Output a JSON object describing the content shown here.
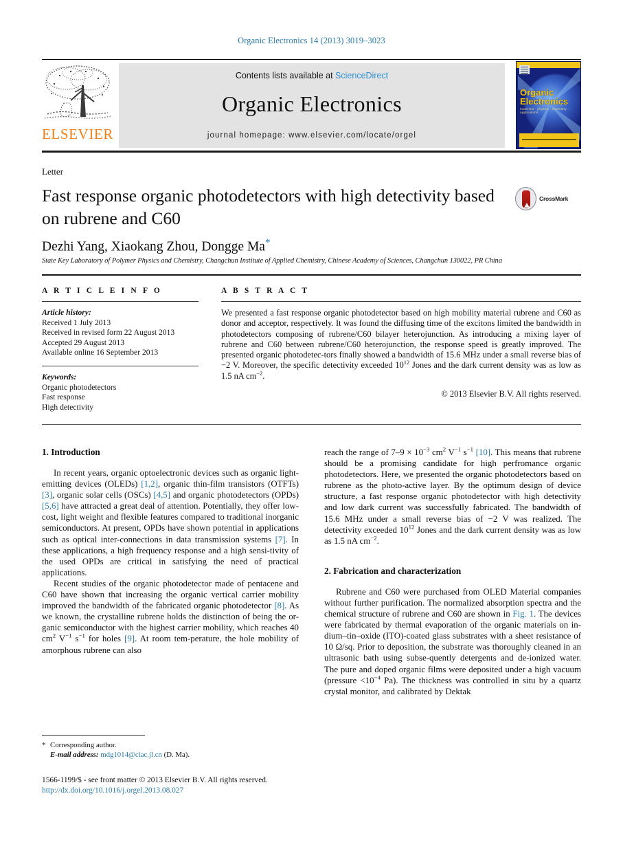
{
  "running_head": "Organic Electronics 14 (2013) 3019–3023",
  "masthead": {
    "contents_prefix": "Contents lists available at ",
    "sciencedirect": "ScienceDirect",
    "journal_name": "Organic Electronics",
    "homepage": "journal homepage: www.elsevier.com/locate/orgel",
    "publisher": "ELSEVIER",
    "cover": {
      "title": "Organic Electronics",
      "subtitle": "materials · physics · chemistry · applications"
    },
    "colors": {
      "link": "#2b8fd6",
      "elsevier_orange": "#f08019",
      "band_grey": "#e3e3e3",
      "cover_blue": "#14227a",
      "cover_yellow": "#f2c41a"
    }
  },
  "article": {
    "type_label": "Letter",
    "title": "Fast response organic photodetectors with high detectivity based on rubrene and C60",
    "authors": "Dezhi Yang, Xiaokang Zhou, Dongge Ma",
    "corresponding_marker": "*",
    "affiliation": "State Key Laboratory of Polymer Physics and Chemistry, Changchun Institute of Applied Chemistry, Chinese Academy of Sciences, Changchun 130022, PR China",
    "crossmark_label": "CrossMark"
  },
  "article_info": {
    "heading": "A R T I C L E    I N F O",
    "history_label": "Article history:",
    "history": [
      "Received 1 July 2013",
      "Received in revised form 22 August 2013",
      "Accepted 29 August 2013",
      "Available online 16 September 2013"
    ],
    "keywords_label": "Keywords:",
    "keywords": [
      "Organic photodetectors",
      "Fast response",
      "High detectivity"
    ]
  },
  "abstract": {
    "heading": "A B S T R A C T",
    "paragraph_1": "We presented a fast response organic photodetector based on high mobility material rubrene and C60 as donor and acceptor, respectively. It was found the diffusing time of the excitons limited the bandwidth in photodetectors composing of rubrene/C60 bilayer heterojunction. As introducing a mixing layer of rubrene and C60 between rubrene/C60 heterojunction, the response speed is greatly improved. The presented organic photodetec-tors finally showed a bandwidth of 15.6 MHz under a small reverse bias of −2 V. Moreover, the specific detectivity exceeded 10",
    "exponent_1": "12",
    "paragraph_1_cont": " Jones and the dark current density was as low as 1.5 nA cm",
    "exponent_2": "−2",
    "paragraph_1_end": ".",
    "copyright": "© 2013 Elsevier B.V. All rights reserved."
  },
  "sections": {
    "introduction": {
      "heading": "1. Introduction",
      "para1_a": "In recent years, organic optoelectronic devices such as organic light-emitting devices (OLEDs) ",
      "ref1": "[1,2]",
      "para1_b": ", organic thin-film transistors (OTFTs) ",
      "ref2": "[3]",
      "para1_c": ", organic solar cells (OSCs) ",
      "ref3": "[4,5]",
      "para1_d": " and organic photodetectors (OPDs) ",
      "ref4": "[5,6]",
      "para1_e": " have attracted a great deal of attention. Potentially, they offer low-cost, light weight and flexible features compared to traditional inorganic semiconductors. At present, OPDs have shown potential in applications such as optical inter-connections in data transmission systems ",
      "ref5": "[7]",
      "para1_f": ". In these applications, a high frequency response and a high sensi-tivity of the used OPDs are critical in satisfying the need of practical applications.",
      "para2_a": "Recent studies of the organic photodetector made of pentacene and C60 have shown that increasing the organic vertical carrier mobility improved the bandwidth of the fabricated organic photodetector ",
      "ref6": "[8]",
      "para2_b": ". As we known, the crystalline rubrene holds the distinction of being the or-ganic semiconductor with the highest carrier mobility, which reaches 40 cm",
      "sup_cm2": "2",
      "para2_c": " V",
      "sup_vm1": "−1",
      "para2_d": " s",
      "sup_sm1": "−1",
      "para2_e": " for holes ",
      "ref7": "[9]",
      "para2_f": ". At room tem-perature, the hole mobility of amorphous rubrene can also",
      "para3_a": "reach the range of 7–9 × 10",
      "sup_e3": "−3",
      "para3_b": " cm",
      "sup_cm2b": "2",
      "para3_c": " V",
      "sup_vm1b": "−1",
      "para3_d": " s",
      "sup_sm1b": "−1",
      "para3_e": " ",
      "ref8": "[10]",
      "para3_f": ". This means that rubrene should be a promising candidate for high perfromance organic photodetectors. Here, we presented the organic photodetectors based on rubrene as the photo-active layer. By the optimum design of device structure, a fast response organic photodetector with high detectivity and low dark current was successfully fabricated. The bandwidth of 15.6 MHz under a small reverse bias of −2 V was realized. The detectivity exceeded 10",
      "sup_12": "12",
      "para3_g": " Jones and the dark current density was as low as 1.5 nA cm",
      "sup_m2": "−2",
      "para3_h": "."
    },
    "fabrication": {
      "heading": "2. Fabrication and characterization",
      "para1_a": "Rubrene and C60 were purchased from OLED Material companies without further purification. The normalized absorption spectra and the chemical structure of rubrene and C60 are shown in ",
      "figlink": "Fig. 1",
      "para1_b": ". The devices were fabricated by thermal evaporation of the organic materials on in-dium–tin–oxide (ITO)-coated glass substrates with a sheet resistance of 10 Ω/sq. Prior to deposition, the substrate was thoroughly cleaned in an ultrasonic bath using subse-quently detergents and de-ionized water. The pure and doped organic films were deposited under a high vacuum (pressure <10",
      "sup_m4": "−4",
      "para1_c": " Pa). The thickness was controlled in situ by a quartz crystal monitor, and calibrated by Dektak"
    }
  },
  "footnote": {
    "star": "*",
    "corresponding": "Corresponding author.",
    "email_label": "E-mail address:",
    "email": "mdg1014@ciac.jl.cn",
    "email_owner": "(D. Ma)."
  },
  "footer": {
    "issn_line": "1566-1199/$ - see front matter © 2013 Elsevier B.V. All rights reserved.",
    "doi": "http://dx.doi.org/10.1016/j.orgel.2013.08.027"
  }
}
